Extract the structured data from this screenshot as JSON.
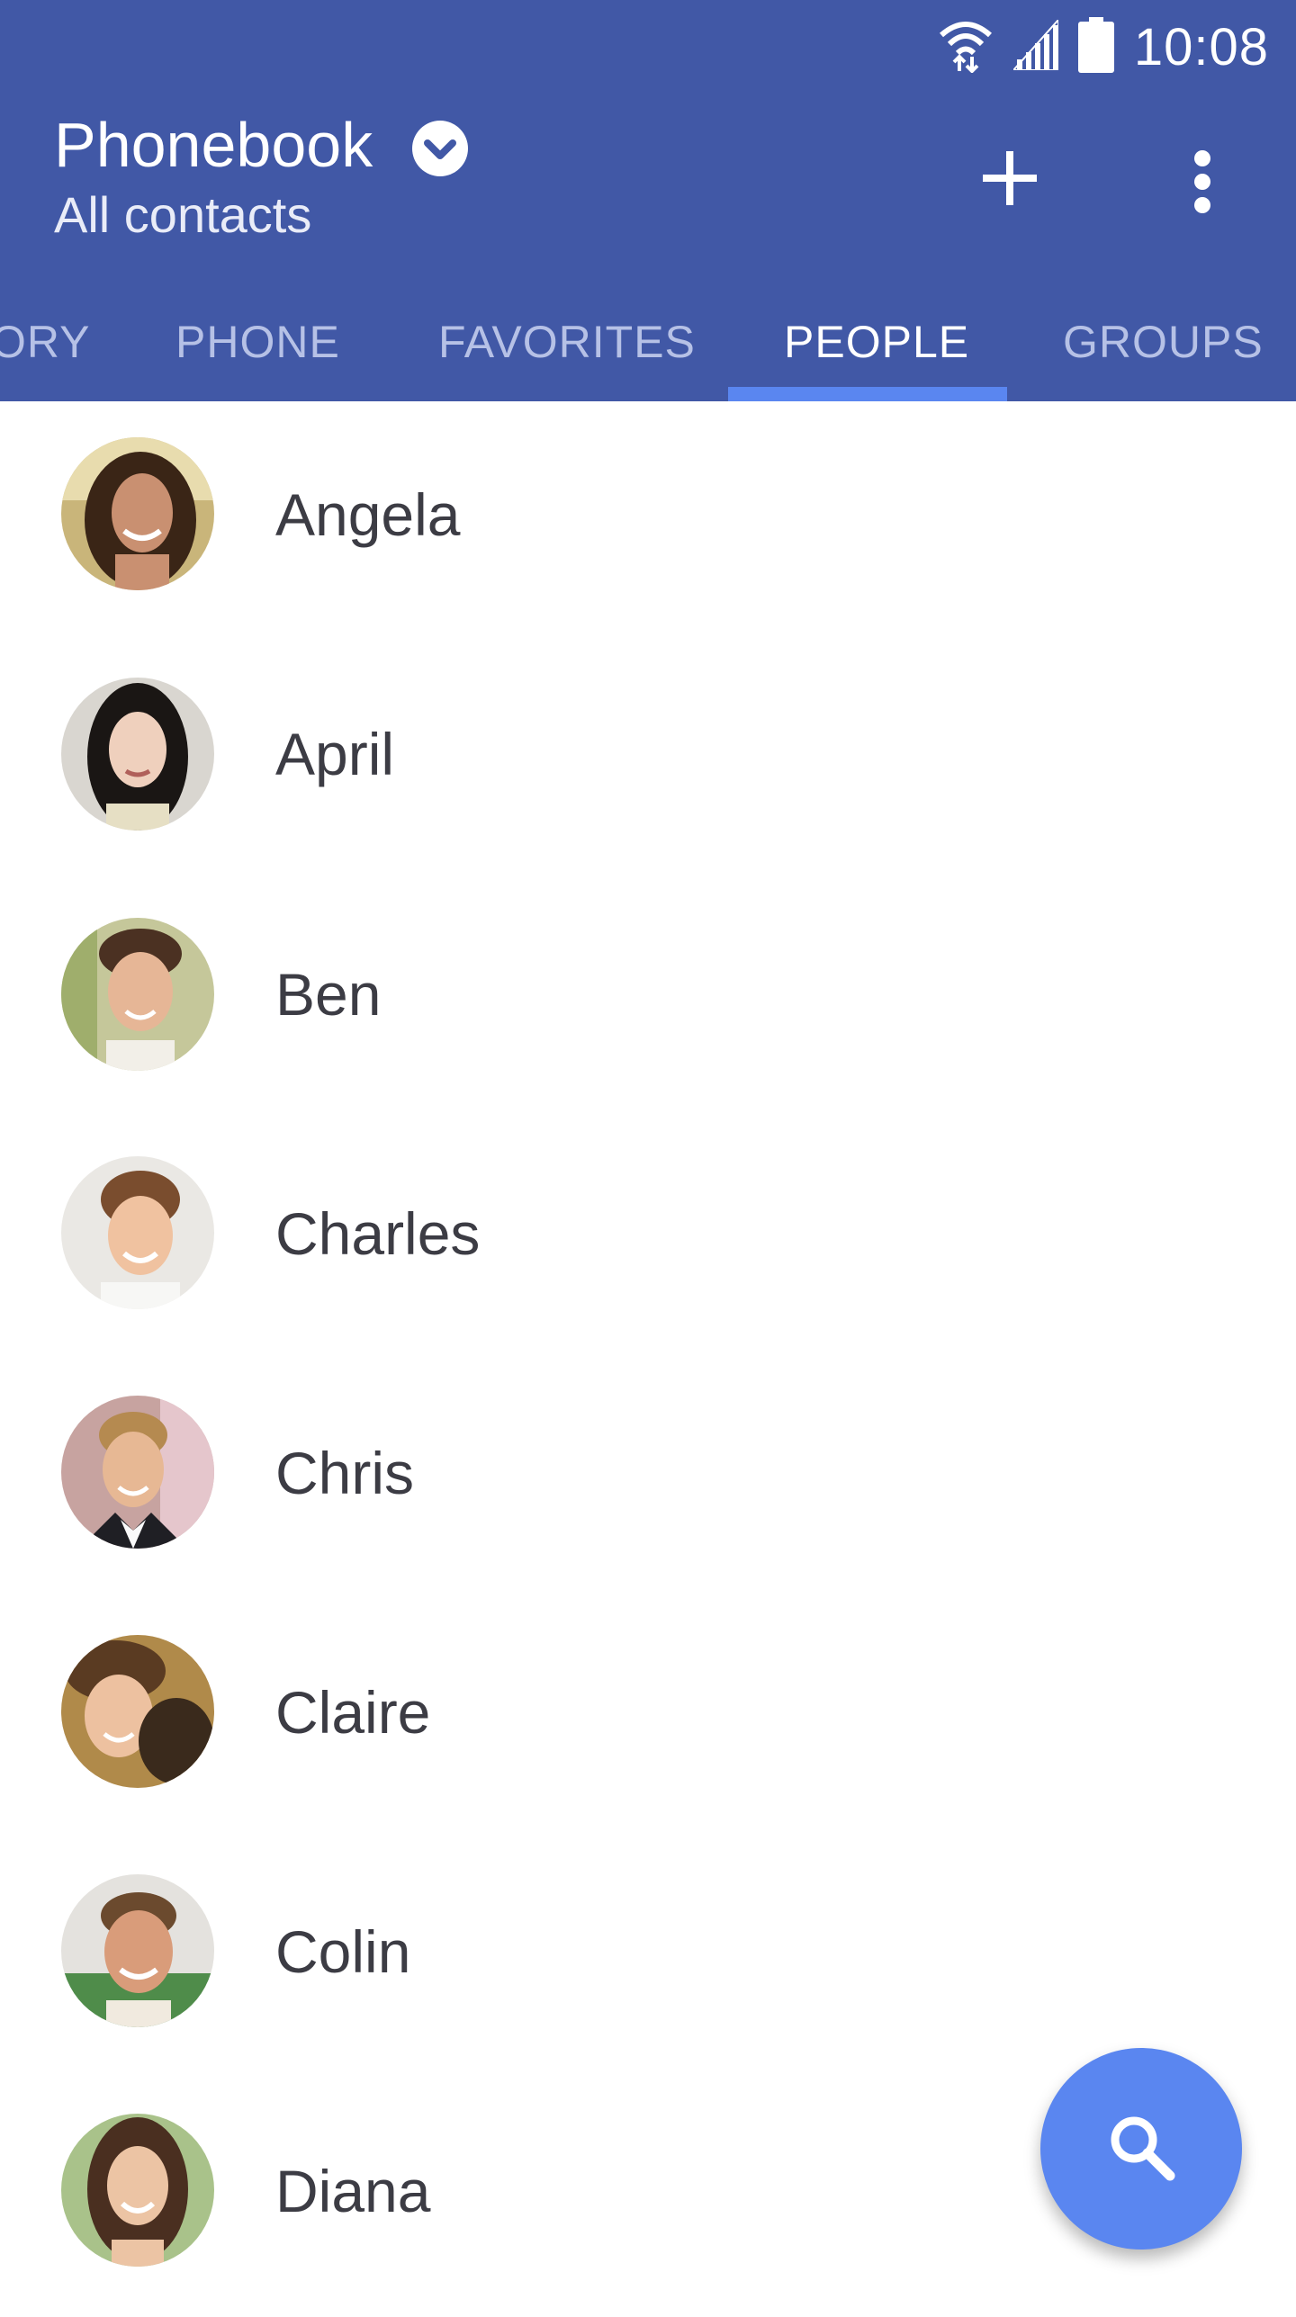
{
  "status_bar": {
    "time": "10:08",
    "icons": [
      "wifi-icon",
      "signal-icon",
      "battery-icon"
    ]
  },
  "header": {
    "title": "Phonebook",
    "subtitle": "All contacts",
    "actions": [
      "add-icon",
      "more-vert-icon"
    ]
  },
  "tabs": [
    {
      "label": "HISTORY",
      "visible_text": "ORY",
      "active": false
    },
    {
      "label": "PHONE",
      "active": false
    },
    {
      "label": "FAVORITES",
      "active": false
    },
    {
      "label": "PEOPLE",
      "active": true
    },
    {
      "label": "GROUPS",
      "active": false
    }
  ],
  "contacts": [
    {
      "name": "Angela"
    },
    {
      "name": "April"
    },
    {
      "name": "Ben"
    },
    {
      "name": "Charles"
    },
    {
      "name": "Chris"
    },
    {
      "name": "Claire"
    },
    {
      "name": "Colin"
    },
    {
      "name": "Diana"
    }
  ],
  "fab": {
    "icon": "search-icon"
  },
  "colors": {
    "appbar": "#4158a6",
    "accent": "#5a86f0",
    "tab_inactive": "#b6c1e6",
    "text_primary": "#3c3c44"
  }
}
